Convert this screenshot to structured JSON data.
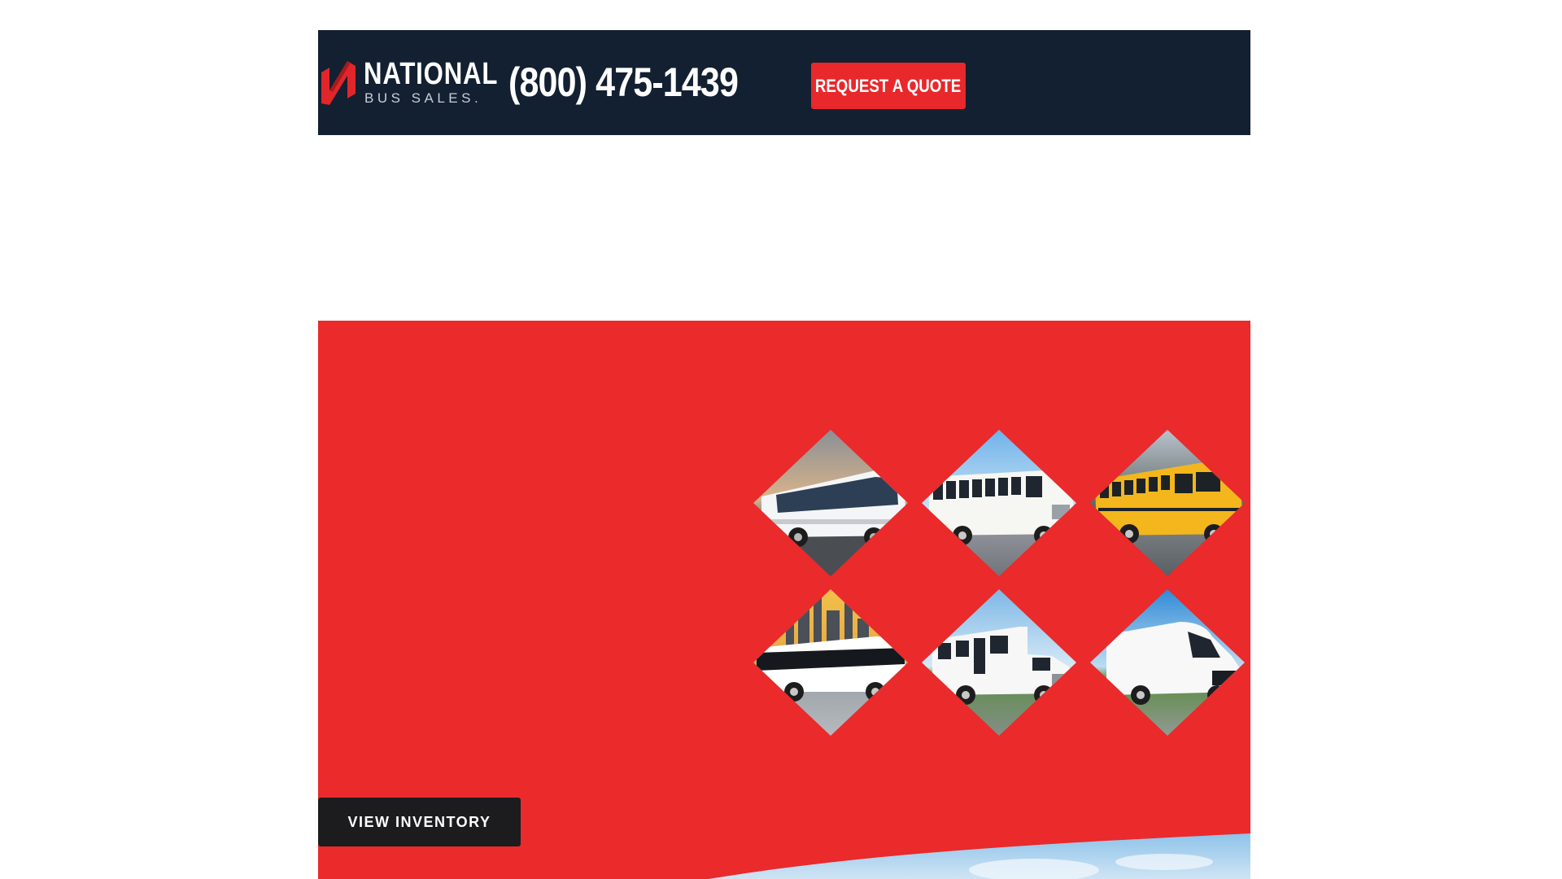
{
  "header": {
    "logo": {
      "name": "NATIONAL",
      "sub": "BUS SALES.",
      "icon": "national-n-logo-mark"
    },
    "phone": "(800) 475-1439",
    "quote_button": "REQUEST A QUOTE"
  },
  "hero": {
    "inventory_button": "VIEW INVENTORY",
    "tiles": [
      {
        "icon": "motorcoach-bus"
      },
      {
        "icon": "activity-bus"
      },
      {
        "icon": "school-bus"
      },
      {
        "icon": "luxury-coach"
      },
      {
        "icon": "shuttle-bus"
      },
      {
        "icon": "cargo-van"
      }
    ]
  },
  "colors": {
    "header_bg": "#132031",
    "accent_red": "#e8282b",
    "hero_red": "#ea2a2b",
    "dark_button": "#1c1c1e",
    "school_yellow": "#f3b61c"
  }
}
